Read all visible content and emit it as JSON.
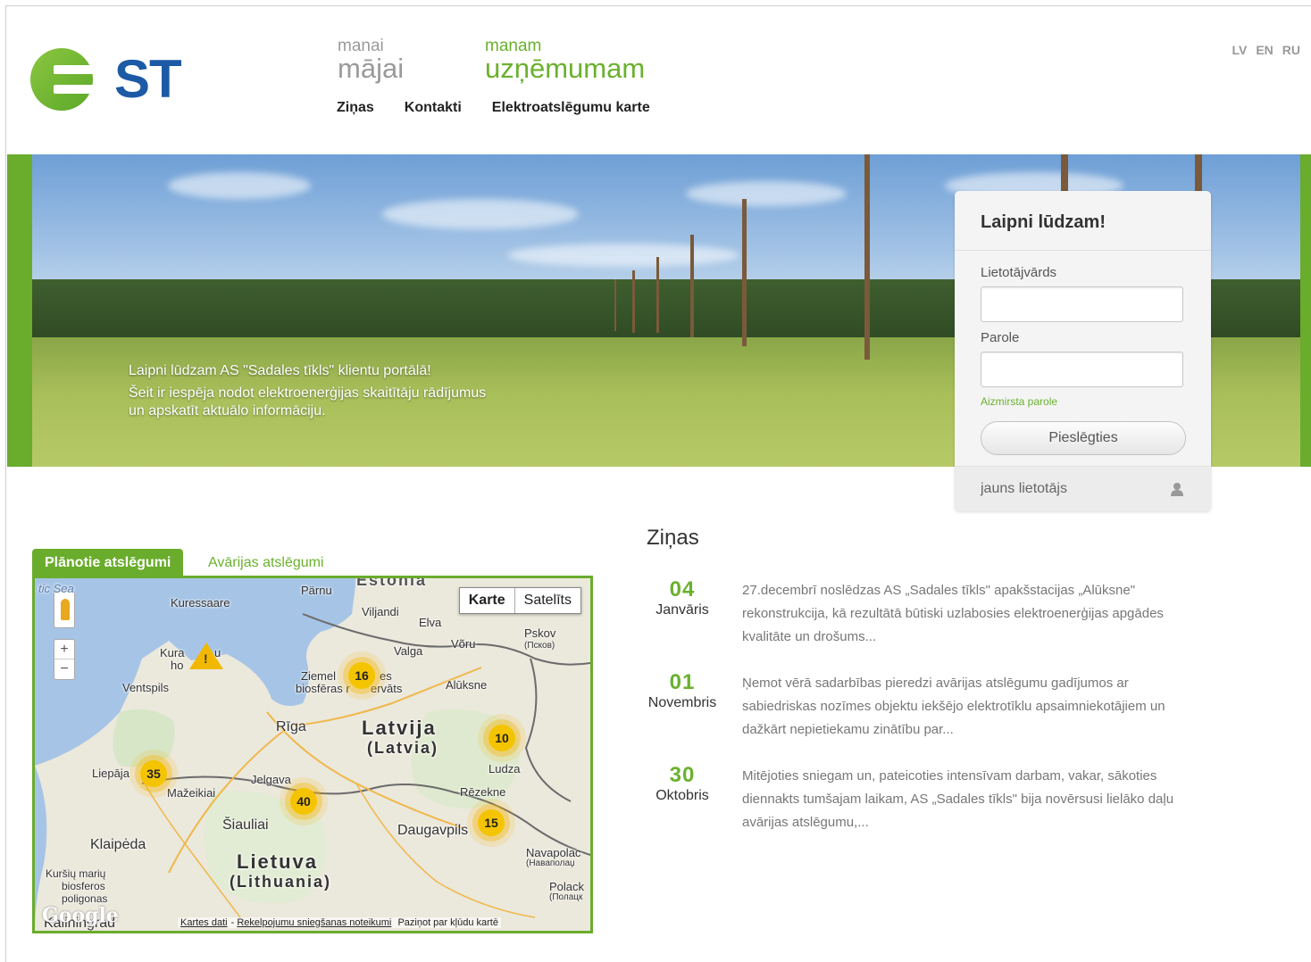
{
  "header": {
    "logo_text": "ST",
    "segments": {
      "home": {
        "small": "manai",
        "large": "mājai"
      },
      "business": {
        "small": "manam",
        "large": "uzņēmumam"
      }
    },
    "nav": [
      "Ziņas",
      "Kontakti",
      "Elektroatslēgumu karte"
    ],
    "languages": [
      "LV",
      "EN",
      "RU"
    ]
  },
  "banner": {
    "caption_title": "Laipni lūdzam AS \"Sadales tīkls\" klientu portālā!",
    "caption_text": "Šeit ir iespēja nodot elektroenerģijas skaitītāju rādījumus un apskatīt aktuālo informāciju."
  },
  "login": {
    "title": "Laipni lūdzam!",
    "username_label": "Lietotājvārds",
    "username_value": "",
    "password_label": "Parole",
    "password_value": "",
    "forgot": "Aizmirsta parole",
    "submit": "Pieslēgties",
    "new_user": "jauns lietotājs",
    "new_user_icon": "user-icon"
  },
  "map_section": {
    "tabs": [
      "Plānotie atslēgumi",
      "Avārijas atslēgumi"
    ],
    "map_types": [
      "Karte",
      "Satelīts"
    ],
    "zoom_in": "+",
    "zoom_out": "−",
    "clusters": [
      "35",
      "16",
      "40",
      "10",
      "15"
    ],
    "labels": {
      "latvija": "Latvija",
      "latvia": "(Latvia)",
      "lietuva": "Lietuva",
      "lithuania": "(Lithuania)",
      "estonia": "Estonia",
      "riga": "Rīga",
      "jelgava": "Jelgava",
      "liepaja": "Liepāja",
      "ventspils": "Ventspils",
      "klaipeda": "Klaipėda",
      "siauliai": "Šiauliai",
      "daugavpils": "Daugavpils",
      "rezekne": "Rēzekne",
      "ludza": "Ludza",
      "aluksne": "Alūksne",
      "valga": "Valga",
      "voru": "Võru",
      "pskov": "Pskov",
      "pskov_ru": "(Псков)",
      "viljandi": "Viljandi",
      "parnu": "Pärnu",
      "elva": "Elva",
      "kuressaare": "Kuressaare",
      "kura": "Kura",
      "kura_ho": "ho",
      "kura_u": "u",
      "gulf": "tic Sea",
      "mazeikiai": "Mažeikiai",
      "navapolac": "Navapolac",
      "navapolac_ru": "(Наваполаџ",
      "polack": "Polack",
      "polack_ru": "(Полацк",
      "kursiu": "Kuršių marių",
      "biosferos": "biosferos",
      "poligonas": "poligonas",
      "kaliningrad": "Kaliningrad",
      "ziemel": "Ziemel",
      "ziemel_2": "es",
      "biosferas": "biosfēras r",
      "biosferas_2": "ervāts"
    },
    "google": "Google",
    "footer": [
      "Kartes dati",
      "Rekelpojumu sniegšanas noteikumi",
      "Paziņot par kļūdu kartē"
    ]
  },
  "news": {
    "title": "Ziņas",
    "items": [
      {
        "day": "04",
        "month": "Janvāris",
        "text": "27.decembrī noslēdzas AS „Sadales tīkls\" apakšstacijas „Alūksne\" rekonstrukcija, kā rezultātā būtiski uzlabosies elektroenerģijas apgādes kvalitāte un drošums..."
      },
      {
        "day": "01",
        "month": "Novembris",
        "text": "Ņemot vērā sadarbības pieredzi avārijas atslēgumu gadījumos ar sabiedriskas nozīmes objektu iekšējo elektrotīklu apsaimniekotājiem un dažkārt nepietiekamu zinātību par..."
      },
      {
        "day": "30",
        "month": "Oktobris",
        "text": "Mitējoties sniegam un, pateicoties intensīvam darbam, vakar, sākoties diennakts tumšajam laikam, AS „Sadales tīkls\" bija novērsusi lielāko daļu avārijas atslēgumu,..."
      }
    ]
  },
  "colors": {
    "accent": "#6ab12e",
    "brand_blue": "#1c5aa6",
    "segment_gray": "#9a9a9a"
  }
}
